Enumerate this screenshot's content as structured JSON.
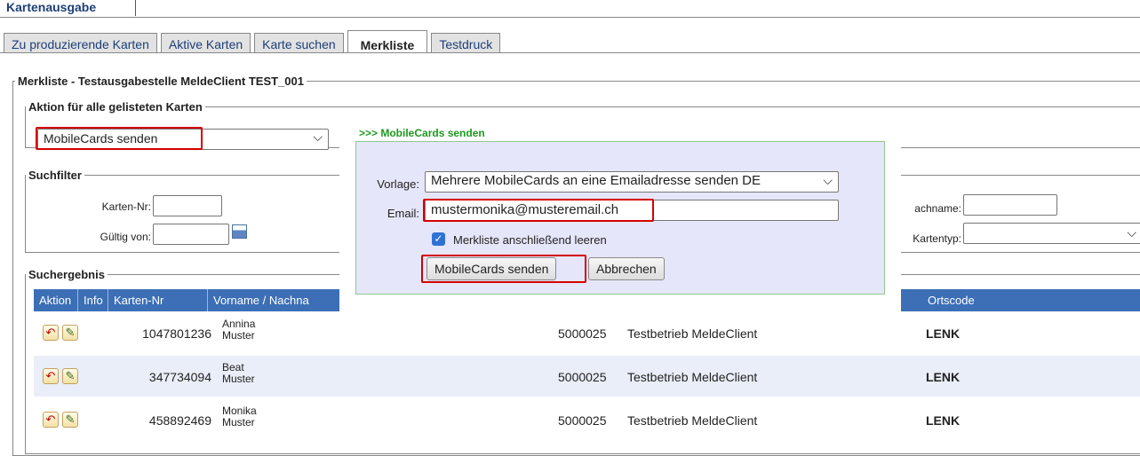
{
  "header": {
    "title": "Kartenausgabe"
  },
  "tabs": [
    {
      "label": "Zu produzierende Karten"
    },
    {
      "label": "Aktive Karten"
    },
    {
      "label": "Karte suchen"
    },
    {
      "label": "Merkliste",
      "active": true
    },
    {
      "label": "Testdruck"
    }
  ],
  "merkliste": {
    "legend": "Merkliste - Testausgabestelle MeldeClient TEST_001"
  },
  "action": {
    "legend": "Aktion für alle gelisteten Karten",
    "select_value": "MobileCards senden"
  },
  "filter": {
    "legend": "Suchfilter",
    "karten_nr_label": "Karten-Nr:",
    "karten_nr_value": "",
    "gueltig_von_label": "Gültig von:",
    "gueltig_von_value": "",
    "nachname_label": "achname:",
    "kartentyp_label": "Kartentyp:"
  },
  "results": {
    "legend": "Suchergebnis",
    "columns": [
      "Aktion",
      "Info",
      "Karten-Nr",
      "Vorname / Nachna",
      "Ortscode"
    ],
    "rows": [
      {
        "karten_nr": "1047801236",
        "vorname": "Annina",
        "nachname": "Muster",
        "betrieb_nr": "5000025",
        "betrieb": "Testbetrieb MeldeClient",
        "ortscode": "LENK"
      },
      {
        "karten_nr": "347734094",
        "vorname": "Beat",
        "nachname": "Muster",
        "betrieb_nr": "5000025",
        "betrieb": "Testbetrieb MeldeClient",
        "ortscode": "LENK"
      },
      {
        "karten_nr": "458892469",
        "vorname": "Monika",
        "nachname": "Muster",
        "betrieb_nr": "5000025",
        "betrieb": "Testbetrieb MeldeClient",
        "ortscode": "LENK"
      }
    ]
  },
  "popup": {
    "title": ">>> MobileCards senden",
    "vorlage_label": "Vorlage:",
    "vorlage_value": "Mehrere MobileCards an eine Emailadresse senden DE",
    "email_label": "Email:",
    "email_value": "mustermonika@musteremail.ch",
    "checkbox_label": "Merkliste anschließend leeren",
    "checkbox_checked": true,
    "send_button": "MobileCards senden",
    "cancel_button": "Abbrechen"
  },
  "icons": {
    "undo": "undo-arrow-icon",
    "edit": "pencil-icon",
    "calendar": "calendar-icon",
    "chevron": "chevron-down-icon"
  },
  "colors": {
    "table_header": "#3c6fb6",
    "row_alt": "#e9eef8",
    "highlight": "#d40000",
    "popup_title": "#1d9a1d"
  }
}
